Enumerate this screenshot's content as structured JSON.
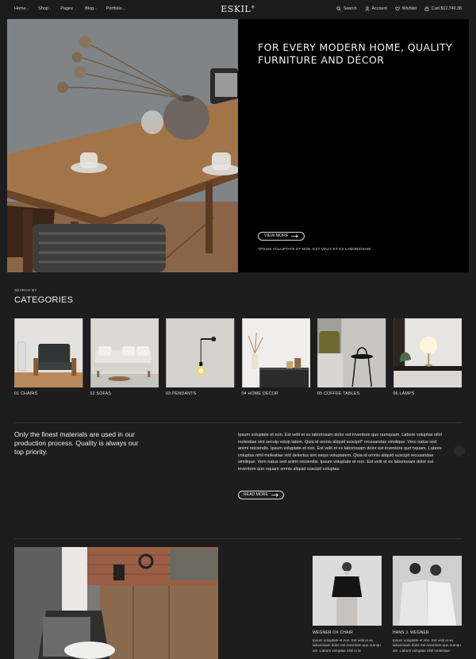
{
  "nav": [
    {
      "label": "Home"
    },
    {
      "label": "Shop"
    },
    {
      "label": "Pages"
    },
    {
      "label": "Blog"
    },
    {
      "label": "Portfolio"
    }
  ],
  "logo": {
    "text": "ESKIL",
    "mark": "®"
  },
  "header_actions": {
    "search": "Search",
    "account": "Account",
    "wishlist": "Wishlist",
    "cart": "Cart $12,740.38"
  },
  "hero": {
    "title": "FOR EVERY MODERN HOME, QUALITY FURNITURE AND DÉCOR",
    "button": "VIEW MORE",
    "subtitle": "*IPSUM VOLUPTATE ET NON. EST VELIT ET EX LABORIOSAM"
  },
  "categories": {
    "eyebrow": "SEARCH BY",
    "title": "CATEGORIES",
    "items": [
      {
        "label": "01 CHAIRS"
      },
      {
        "label": "02 SOFAS"
      },
      {
        "label": "03 PENDANTS"
      },
      {
        "label": "04 HOME DECOR"
      },
      {
        "label": "05 COFFEE TABLES"
      },
      {
        "label": "06 LAMPS"
      }
    ]
  },
  "about": {
    "quote": "Only the finest materials are used in our production process. Quality is always our top priority.",
    "paragraph": "Ipsum voluptate et non. Est velit et ex laboriosam dolor est inventore quo numquam. Labore voluptas nihil molestiae sint secuip volup tatem. Quia id omnis aliquid suscipit* recusandae similique. Vero natus sed animi reiciendis. Ipsum voluptate et non. Est velit et ex laboriosam dolor est inventore quo nquam. Labore voluptas nihil molestiae sint delectus sint sequi voluptatem. Quia id omnis aliquid suscipit recusandae similique. Vero natus sed animi reiciendis. Ipsum voluptate et non. Est velit et ex laboriosam dolor est inventore quo nquam omnis aliquid suscipit voluptas.",
    "button": "READ MORE"
  },
  "people": [
    {
      "name": "WEGNER OX CHAIR",
      "desc": "Ipsum voluptate et non. Est velit et ex laboriosam dolor est inventore quo numqu am. Labore voluptas nihil m le"
    },
    {
      "name": "HANS J. WEGNER",
      "desc": "Ipsum voluptate et non. Est velit et ex laboriosam dolor est inventore quo numqu am. Labore voluptas nihil molestiae"
    }
  ],
  "colors": {
    "background": "#1d1d1d",
    "hero_panel": "#000000",
    "text": "#f0f0f0"
  }
}
